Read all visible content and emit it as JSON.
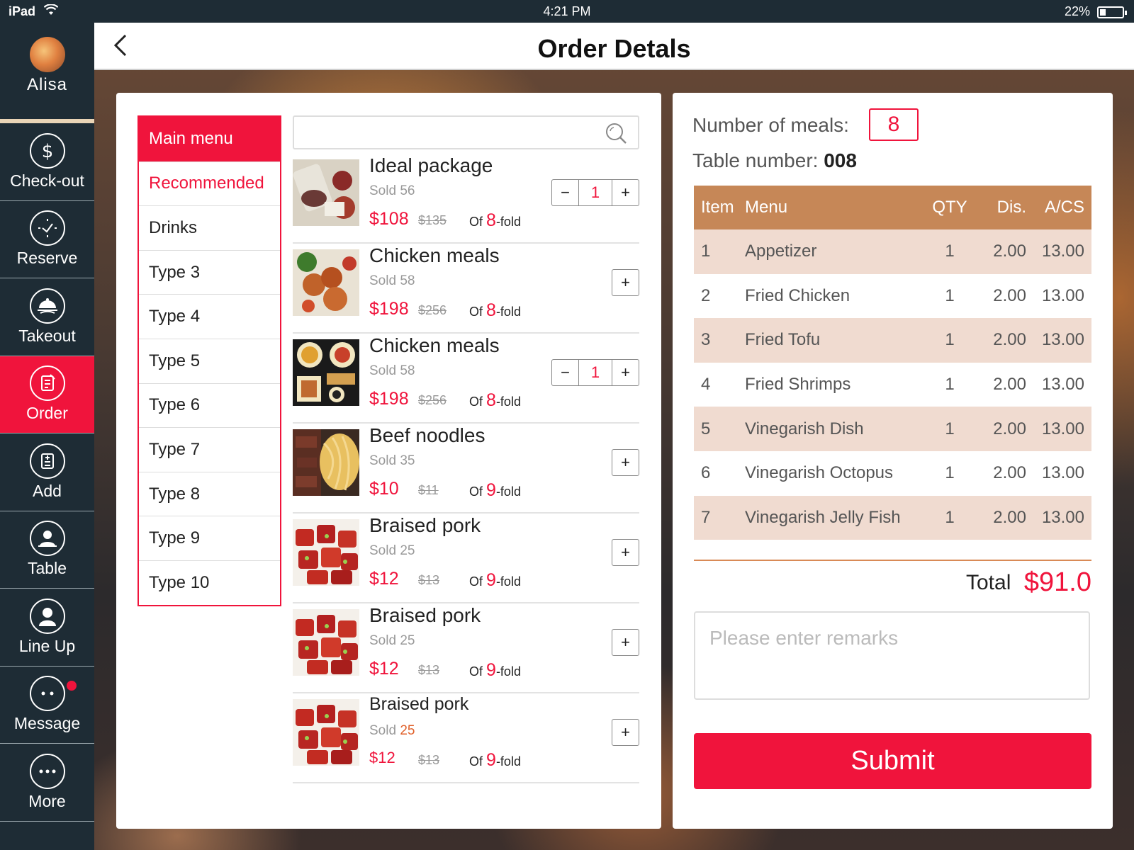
{
  "status_bar": {
    "device": "iPad",
    "time": "4:21 PM",
    "battery": "22%"
  },
  "profile": {
    "name": "Alisa"
  },
  "nav": [
    {
      "label": "Check-out",
      "icon": "dollar-icon"
    },
    {
      "label": "Reserve",
      "icon": "clock-icon"
    },
    {
      "label": "Takeout",
      "icon": "cloche-icon"
    },
    {
      "label": "Order",
      "icon": "order-icon",
      "active": true
    },
    {
      "label": "Add",
      "icon": "add-document-icon"
    },
    {
      "label": "Table",
      "icon": "table-person-icon"
    },
    {
      "label": "Line Up",
      "icon": "person-icon"
    },
    {
      "label": "Message",
      "icon": "chat-icon",
      "badge": true
    },
    {
      "label": "More",
      "icon": "more-icon"
    }
  ],
  "header": {
    "title": "Order Detals"
  },
  "categories": [
    "Main menu",
    "Recommended",
    "Drinks",
    "Type 3",
    "Type 4",
    "Type 5",
    "Type 6",
    "Type 7",
    "Type 8",
    "Type 9",
    "Type 10"
  ],
  "search": {
    "placeholder": ""
  },
  "dishes": [
    {
      "name": "Ideal package",
      "sold_label": "Sold",
      "sold": "56",
      "price": "$108",
      "original": "$135",
      "fold_prefix": "Of",
      "fold": "8",
      "fold_suffix": "-fold",
      "qty": "1"
    },
    {
      "name": "Chicken meals",
      "sold_label": "Sold",
      "sold": "58",
      "price": "$198",
      "original": "$256",
      "fold_prefix": "Of",
      "fold": "8",
      "fold_suffix": "-fold"
    },
    {
      "name": "Chicken meals",
      "sold_label": "Sold",
      "sold": "58",
      "price": "$198",
      "original": "$256",
      "fold_prefix": "Of",
      "fold": "8",
      "fold_suffix": "-fold",
      "qty": "1"
    },
    {
      "name": "Beef noodles",
      "sold_label": "Sold",
      "sold": "35",
      "price": "$10",
      "original": "$11",
      "fold_prefix": "Of",
      "fold": "9",
      "fold_suffix": "-fold"
    },
    {
      "name": "Braised pork",
      "sold_label": "Sold",
      "sold": "25",
      "price": "$12",
      "original": "$13",
      "fold_prefix": "Of",
      "fold": "9",
      "fold_suffix": "-fold"
    },
    {
      "name": "Braised pork",
      "sold_label": "Sold",
      "sold": "25",
      "price": "$12",
      "original": "$13",
      "fold_prefix": "Of",
      "fold": "9",
      "fold_suffix": "-fold"
    },
    {
      "name": "Braised pork",
      "sold_label": "Sold",
      "sold": "25",
      "price": "$12",
      "original": "$13",
      "fold_prefix": "Of",
      "fold": "9",
      "fold_suffix": "-fold"
    }
  ],
  "order": {
    "meals_label": "Number of meals:",
    "meals": "8",
    "table_label": "Table number:",
    "table": "008",
    "columns": [
      "Item",
      "Menu",
      "QTY",
      "Dis.",
      "A/CS"
    ],
    "rows": [
      [
        "1",
        "Appetizer",
        "1",
        "2.00",
        "13.00"
      ],
      [
        "2",
        "Fried Chicken",
        "1",
        "2.00",
        "13.00"
      ],
      [
        "3",
        "Fried Tofu",
        "1",
        "2.00",
        "13.00"
      ],
      [
        "4",
        "Fried Shrimps",
        "1",
        "2.00",
        "13.00"
      ],
      [
        "5",
        "Vinegarish Dish",
        "1",
        "2.00",
        "13.00"
      ],
      [
        "6",
        "Vinegarish Octopus",
        "1",
        "2.00",
        "13.00"
      ],
      [
        "7",
        "Vinegarish Jelly Fish",
        "1",
        "2.00",
        "13.00"
      ]
    ],
    "total_label": "Total",
    "total": "$91.0",
    "remarks_placeholder": "Please enter remarks",
    "submit_label": "Submit"
  },
  "colors": {
    "accent": "#f0143c",
    "sidebar": "#1e2c35",
    "table_header": "#c68757",
    "table_stripe": "#f0dbd0"
  }
}
